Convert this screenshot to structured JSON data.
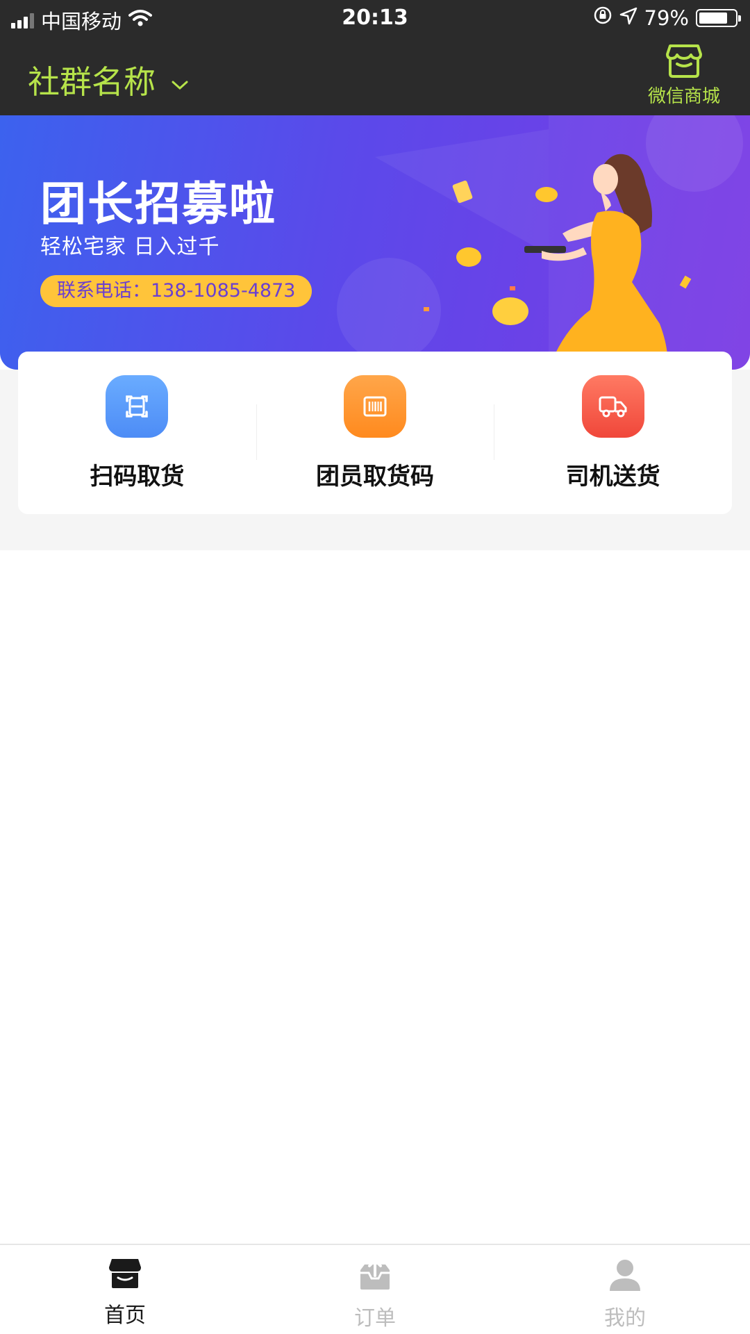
{
  "status_bar": {
    "carrier": "中国移动",
    "time": "20:13",
    "battery": "79%",
    "battery_level": 0.79
  },
  "header": {
    "community_name": "社群名称",
    "shop_label": "微信商城"
  },
  "banner": {
    "title": "团长招募啦",
    "subtitle": "轻松宅家 日入过千",
    "phone": "联系电话：138-1085-4873"
  },
  "actions": [
    {
      "label": "扫码取货",
      "icon": "scan-icon",
      "color": "#5a9bff"
    },
    {
      "label": "团员取货码",
      "icon": "barcode-icon",
      "color": "#ff961f"
    },
    {
      "label": "司机送货",
      "icon": "truck-icon",
      "color": "#f5503f"
    }
  ],
  "tabbar": {
    "items": [
      {
        "label": "首页",
        "icon": "store-icon",
        "active": true
      },
      {
        "label": "订单",
        "icon": "upload-box-icon",
        "active": false
      },
      {
        "label": "我的",
        "icon": "user-icon",
        "active": false
      }
    ]
  },
  "colors": {
    "header_bg": "#2b2b2b",
    "accent_green": "#b6e34a",
    "banner_yellow": "#ffc43a"
  }
}
